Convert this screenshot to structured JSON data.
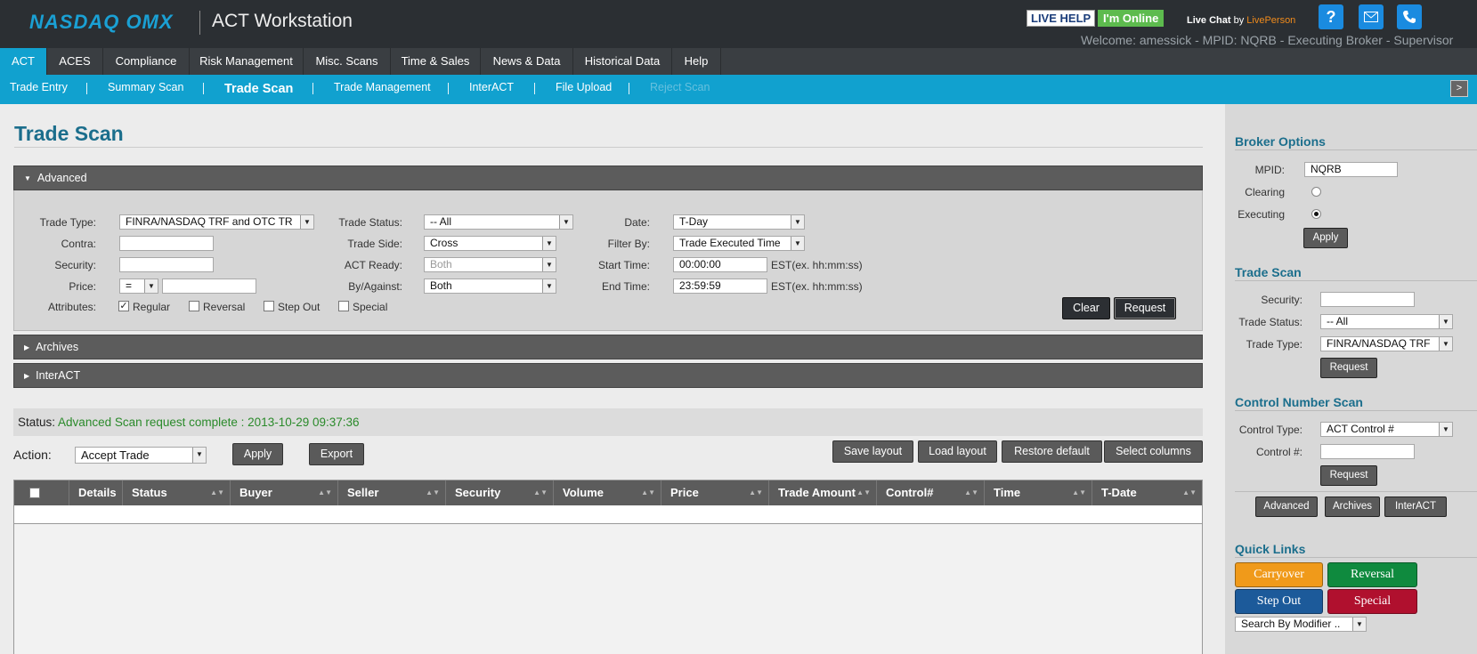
{
  "header": {
    "logo": "NASDAQ OMX",
    "app_title": "ACT Workstation",
    "live_help": "LIVE HELP",
    "online": "I'm Online",
    "live_chat_by": "Live Chat",
    "by": "by",
    "live_person": "LivePerson",
    "welcome": "Welcome: amessick - MPID: NQRB - Executing Broker - Supervisor"
  },
  "nav": {
    "items": [
      "ACT",
      "ACES",
      "Compliance",
      "Risk Management",
      "Misc. Scans",
      "Time & Sales",
      "News & Data",
      "Historical Data",
      "Help"
    ]
  },
  "subnav": {
    "items": [
      "Trade Entry",
      "Summary Scan",
      "Trade Scan",
      "Trade Management",
      "InterACT",
      "File Upload",
      "Reject Scan"
    ],
    "collapse": ">"
  },
  "page": {
    "title": "Trade Scan",
    "advanced": "Advanced",
    "archives": "Archives",
    "interact": "InterACT"
  },
  "form": {
    "trade_type_label": "Trade Type:",
    "trade_type": "FINRA/NASDAQ TRF and OTC TR",
    "contra_label": "Contra:",
    "security_label": "Security:",
    "price_label": "Price:",
    "price_op": "=",
    "attributes_label": "Attributes:",
    "regular": "Regular",
    "reversal": "Reversal",
    "step_out": "Step Out",
    "special": "Special",
    "trade_status_label": "Trade Status:",
    "trade_status": "-- All",
    "trade_side_label": "Trade Side:",
    "trade_side": "Cross",
    "act_ready_label": "ACT Ready:",
    "act_ready": "Both",
    "by_against_label": "By/Against:",
    "by_against": "Both",
    "date_label": "Date:",
    "date": "T-Day",
    "filter_by_label": "Filter By:",
    "filter_by": "Trade Executed Time",
    "start_time_label": "Start Time:",
    "start_time": "00:00:00",
    "end_time_label": "End Time:",
    "end_time": "23:59:59",
    "time_hint": "EST(ex. hh:mm:ss)",
    "clear": "Clear",
    "request": "Request"
  },
  "status": {
    "label": "Status:",
    "value": "Advanced Scan request complete : 2013-10-29 09:37:36"
  },
  "actions": {
    "action_label": "Action:",
    "action_value": "Accept Trade",
    "apply": "Apply",
    "export": "Export",
    "save_layout": "Save layout",
    "load_layout": "Load layout",
    "restore_default": "Restore default",
    "select_columns": "Select columns"
  },
  "table": {
    "columns": [
      "Details",
      "Status",
      "Buyer",
      "Seller",
      "Security",
      "Volume",
      "Price",
      "Trade Amount",
      "Control#",
      "Time",
      "T-Date"
    ]
  },
  "sidebar": {
    "broker_options": "Broker Options",
    "mpid_label": "MPID:",
    "mpid": "NQRB",
    "clearing": "Clearing",
    "executing": "Executing",
    "apply": "Apply",
    "trade_scan": "Trade Scan",
    "security_label": "Security:",
    "trade_status_label": "Trade Status:",
    "trade_status": "-- All",
    "trade_type_label": "Trade Type:",
    "trade_type": "FINRA/NASDAQ TRF",
    "request": "Request",
    "control_scan": "Control Number Scan",
    "control_type_label": "Control Type:",
    "control_type": "ACT Control #",
    "control_no_label": "Control #:",
    "request2": "Request",
    "btn_advanced": "Advanced",
    "btn_archives": "Archives",
    "btn_interact": "InterACT",
    "quick_links": "Quick Links",
    "carryover": "Carryover",
    "reversal": "Reversal",
    "step_out": "Step Out",
    "special": "Special",
    "search_modifier": "Search By Modifier ..",
    "colors": {
      "carryover": "#f09a1a",
      "reversal": "#0f8a3e",
      "step_out": "#1c5a9a",
      "special": "#b0102e"
    }
  }
}
